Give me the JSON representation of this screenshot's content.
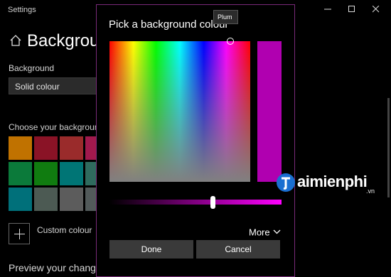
{
  "window": {
    "app_title": "Settings"
  },
  "settings": {
    "page_title": "Background",
    "background_label": "Background",
    "background_value": "Solid colour",
    "choose_label": "Choose your background colour",
    "swatches": [
      "#c07200",
      "#8a1326",
      "#9a2b2b",
      "#a1194d",
      "#0b7a3a",
      "#107c10",
      "#007575",
      "#2f6b5e",
      "#00707a",
      "#4c5a53",
      "#5c5c5c",
      "#525a5a"
    ],
    "custom_colour_label": "Custom colour",
    "preview_label": "Preview your change"
  },
  "dialog": {
    "title": "Pick a background colour",
    "tooltip": "Plum",
    "preview_colour": "#b000b0",
    "brightness_fraction": 0.6,
    "more_label": "More",
    "done_label": "Done",
    "cancel_label": "Cancel"
  },
  "watermark": {
    "text": "aimienphi",
    "suffix": ".vn"
  }
}
